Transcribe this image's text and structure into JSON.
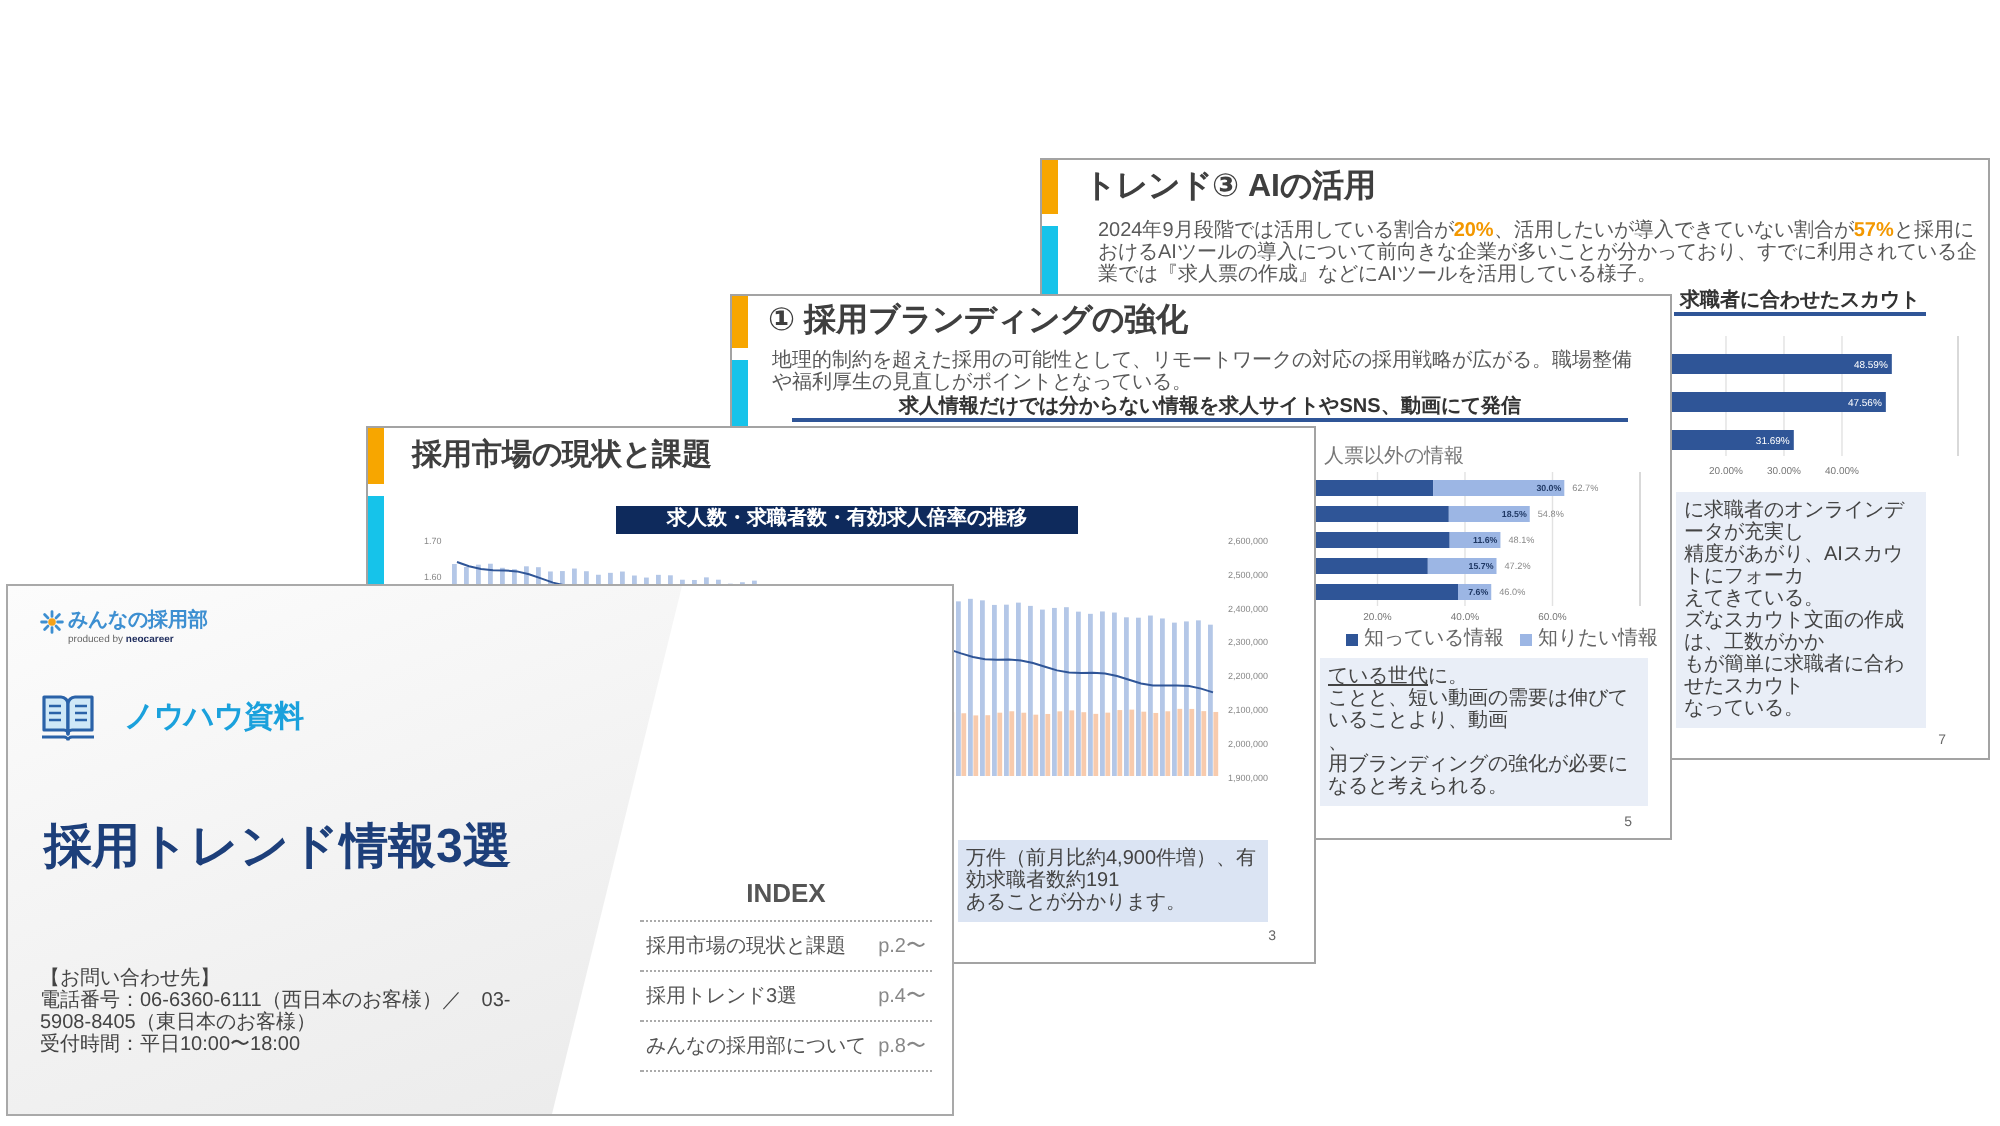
{
  "ai_slide": {
    "title": "トレンド③ AIの活用",
    "lead": "2024年9月段階では活用している割合が**20%**、活用したいが導入できていない割合が**57%**と採用におけるAIツールの導入について前向きな企業が多いことが分かっており、すでに利用されている企業では『求人票の作成』などにAIツールを活用している様子。",
    "heading": "求職者に合わせたスカウト",
    "chart_data": {
      "type": "bar",
      "orientation": "horizontal",
      "values": [
        48.59,
        47.56,
        31.69
      ],
      "xlim": [
        0,
        60
      ],
      "xticks": [
        {
          "value": 20,
          "label": "20.00%"
        },
        {
          "value": 30,
          "label": "30.00%"
        },
        {
          "value": 40,
          "label": "40.00%"
        }
      ],
      "grid": true,
      "value_labels": [
        "48.59%",
        "47.56%",
        "31.69%"
      ]
    },
    "note_lines": [
      "に求職者のオンラインデータが充実し",
      "精度があがり、AIスカウトにフォーカ",
      "えてきている。",
      "ズなスカウト文面の作成は、工数がかか",
      "もが簡単に求職者に合わせたスカウト",
      "なっている。"
    ],
    "page_number": "7"
  },
  "branding_slide": {
    "title": "① 採用ブランディングの強化",
    "lead": "地理的制約を超えた採用の可能性として、リモートワークの対応の採用戦略が広がる。職場整備や福利厚生の見直しがポイントとなっている。",
    "heading": "求人情報だけでは分からない情報を求人サイトやSNS、動画にて発信",
    "chart_data": {
      "type": "bar",
      "orientation": "horizontal",
      "stacked": true,
      "title": "人票以外の情報",
      "series": [
        {
          "name": "知っている情報",
          "color": "#2f5597",
          "values": [
            32.7,
            36.3,
            36.5,
            31.5,
            38.4
          ]
        },
        {
          "name": "知りたい情報",
          "color": "#9cb6e4",
          "values": [
            30.0,
            18.5,
            11.6,
            15.7,
            7.6
          ]
        }
      ],
      "xlim": [
        0,
        80
      ],
      "xticks": [
        {
          "value": 20,
          "label": "20.0%"
        },
        {
          "value": 40,
          "label": "40.0%"
        },
        {
          "value": 60,
          "label": "60.0%"
        }
      ],
      "grid": true,
      "value_labels": [
        {
          "inner": "30.0%",
          "total": "62.7%"
        },
        {
          "inner": "18.5%",
          "total": "54.8%"
        },
        {
          "inner": "11.6%",
          "total": "48.1%"
        },
        {
          "inner": "15.7%",
          "total": "47.2%"
        },
        {
          "inner": "7.6%",
          "total": "46.0%"
        }
      ]
    },
    "note_lines": [
      [
        {
          "text": "ている世代",
          "underline": true
        },
        {
          "text": "に。",
          "underline": false
        }
      ],
      [
        {
          "text": "ことと、短い動画の需要は伸びていることより、動画",
          "underline": false
        }
      ],
      [
        {
          "text": "、",
          "underline": false
        }
      ],
      [
        {
          "text": "用ブランディングの強化が必要になると考えられる。",
          "underline": false
        }
      ]
    ],
    "page_number": "5"
  },
  "market_slide": {
    "title": "採用市場の現状と課題",
    "chart_title": "求人数・求職者数・有効求人倍率の推移",
    "left_axis_labels": [
      "1.70",
      "1.60"
    ],
    "right_axis_labels": [
      "2,600,000",
      "2,500,000",
      "2,400,000",
      "2,300,000",
      "2,200,000",
      "2,100,000",
      "2,000,000",
      "1,900,000"
    ],
    "note_lines": [
      "万件（前月比約4,900件増）、有効求職者数約191",
      "あることが分かります。"
    ],
    "page_number": "3"
  },
  "cover": {
    "brand": "みんなの採用部",
    "byline": "produced by **neocareer**",
    "category": "ノウハウ資料",
    "title": "採用トレンド情報3選",
    "contact_heading": "【お問い合わせ先】",
    "contact_lines": [
      "電話番号：06-6360-6111（西日本のお客様）／　03-5908-8405（東日本のお客様）",
      "受付時間：平日10:00〜18:00"
    ],
    "index_title": "INDEX",
    "index_items": [
      {
        "label": "採用市場の現状と課題",
        "page": "p.2〜"
      },
      {
        "label": "採用トレンド3選",
        "page": "p.4〜"
      },
      {
        "label": "みんなの採用部について",
        "page": "p.8〜"
      }
    ]
  }
}
